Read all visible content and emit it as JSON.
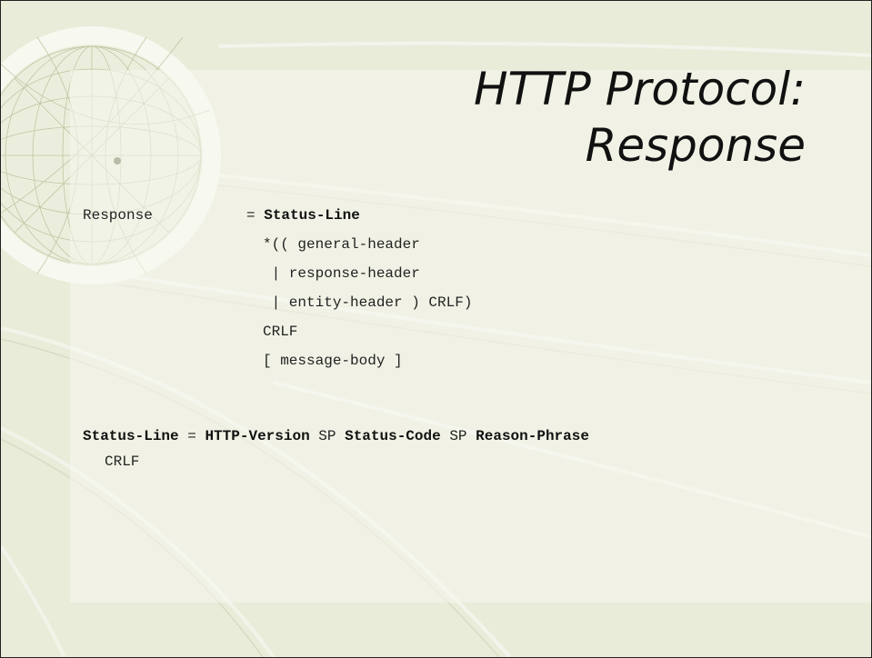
{
  "title": {
    "line1": "HTTP Protocol:",
    "line2": "Response"
  },
  "response_rule": {
    "lhs": "Response",
    "eq": "=",
    "status_line": "Status-Line",
    "line2": "*(( general-header",
    "line3": " | response-header",
    "line4": " | entity-header ) CRLF)",
    "line5": "CRLF",
    "line6": "[ message-body ]"
  },
  "status_rule": {
    "lhs": "Status-Line",
    "eq": "=",
    "http_version": "HTTP-Version",
    "sp1": "SP",
    "status_code": "Status-Code",
    "sp2": "SP",
    "reason_phrase": "Reason-Phrase",
    "crlf": "CRLF"
  },
  "colors": {
    "background": "#e8ecd9",
    "globe_ring": "#f6f7ee",
    "globe_lines": "#cdd3b6"
  }
}
